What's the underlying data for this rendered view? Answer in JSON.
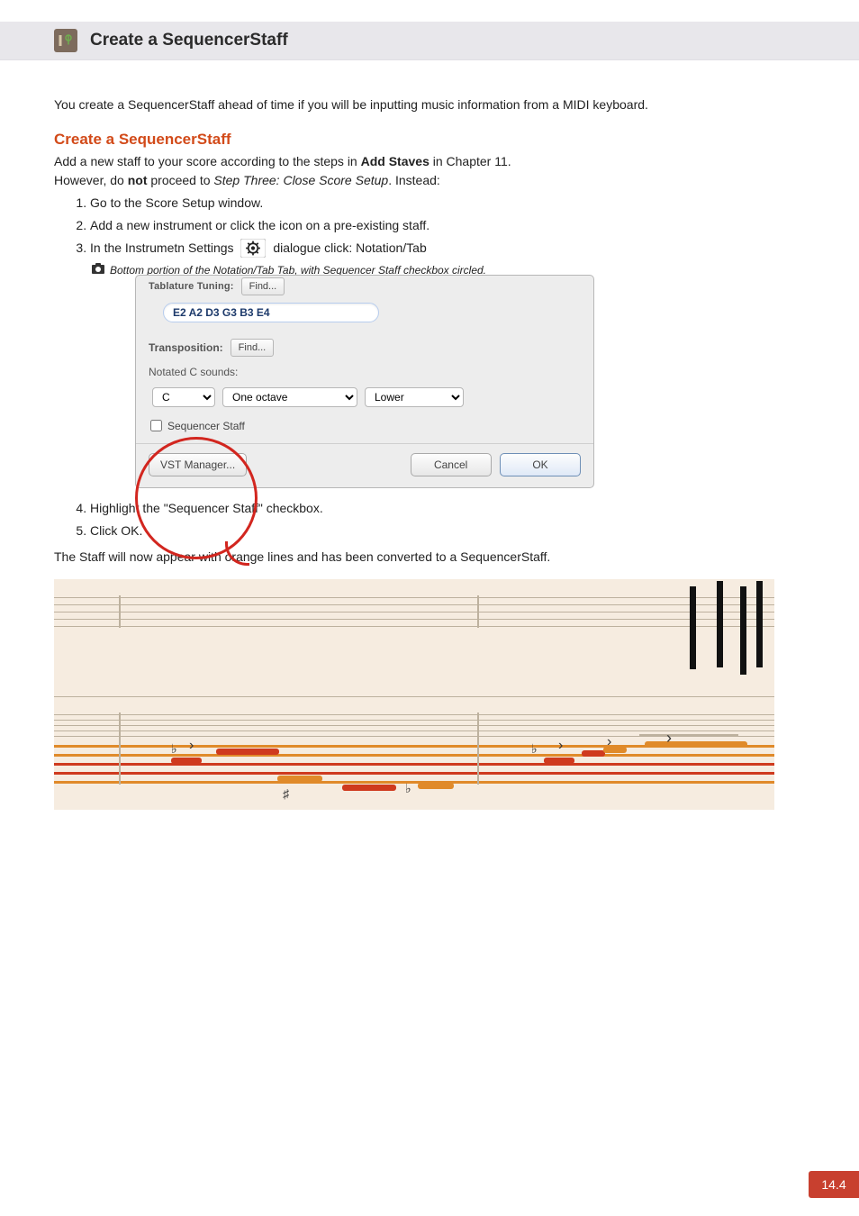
{
  "title_bar": {
    "heading": "Create a SequencerStaff"
  },
  "intro": "You create a SequencerStaff ahead of time if you will be inputting music information from a MIDI keyboard.",
  "subheading": "Create a SequencerStaff",
  "body": {
    "p1_a": "Add a new staff to your score according to the steps in ",
    "p1_strong": "Add Staves",
    "p1_b": " in Chapter 11.",
    "p2_a": "However, do ",
    "p2_strong": "not",
    "p2_b": " proceed to ",
    "p2_em": "Step Three: Close Score Setup",
    "p2_c": ". Instead:"
  },
  "list_a": {
    "i1": "Go to the Score Setup window.",
    "i2": "Add a new instrument or click the icon on a pre-existing staff.",
    "i3_a": "In the Instrumetn Settings",
    "i3_b": "dialogue click: Notation/Tab"
  },
  "caption_text": "Bottom portion of the Notation/Tab Tab, with Sequencer Staff checkbox circled.",
  "dlg": {
    "tab_tuning_label": "Tablature Tuning:",
    "find": "Find...",
    "tuning_value": "E2 A2 D3 G3 B3 E4",
    "transposition_label": "Transposition:",
    "notated_label": "Notated C sounds:",
    "sel1": "C",
    "sel2": "One octave",
    "sel3": "Lower",
    "sequencer_label": "Sequencer Staff",
    "vst": "VST Manager...",
    "cancel": "Cancel",
    "ok": "OK",
    "ghost1": "",
    "ghost2": ""
  },
  "list_b": {
    "i4": "Highlight the \"Sequencer Staff\" checkbox.",
    "i5": "Click OK."
  },
  "closing": "The Staff will now appear with orange lines and has been converted to a SequencerStaff.",
  "page_number": "14.4"
}
